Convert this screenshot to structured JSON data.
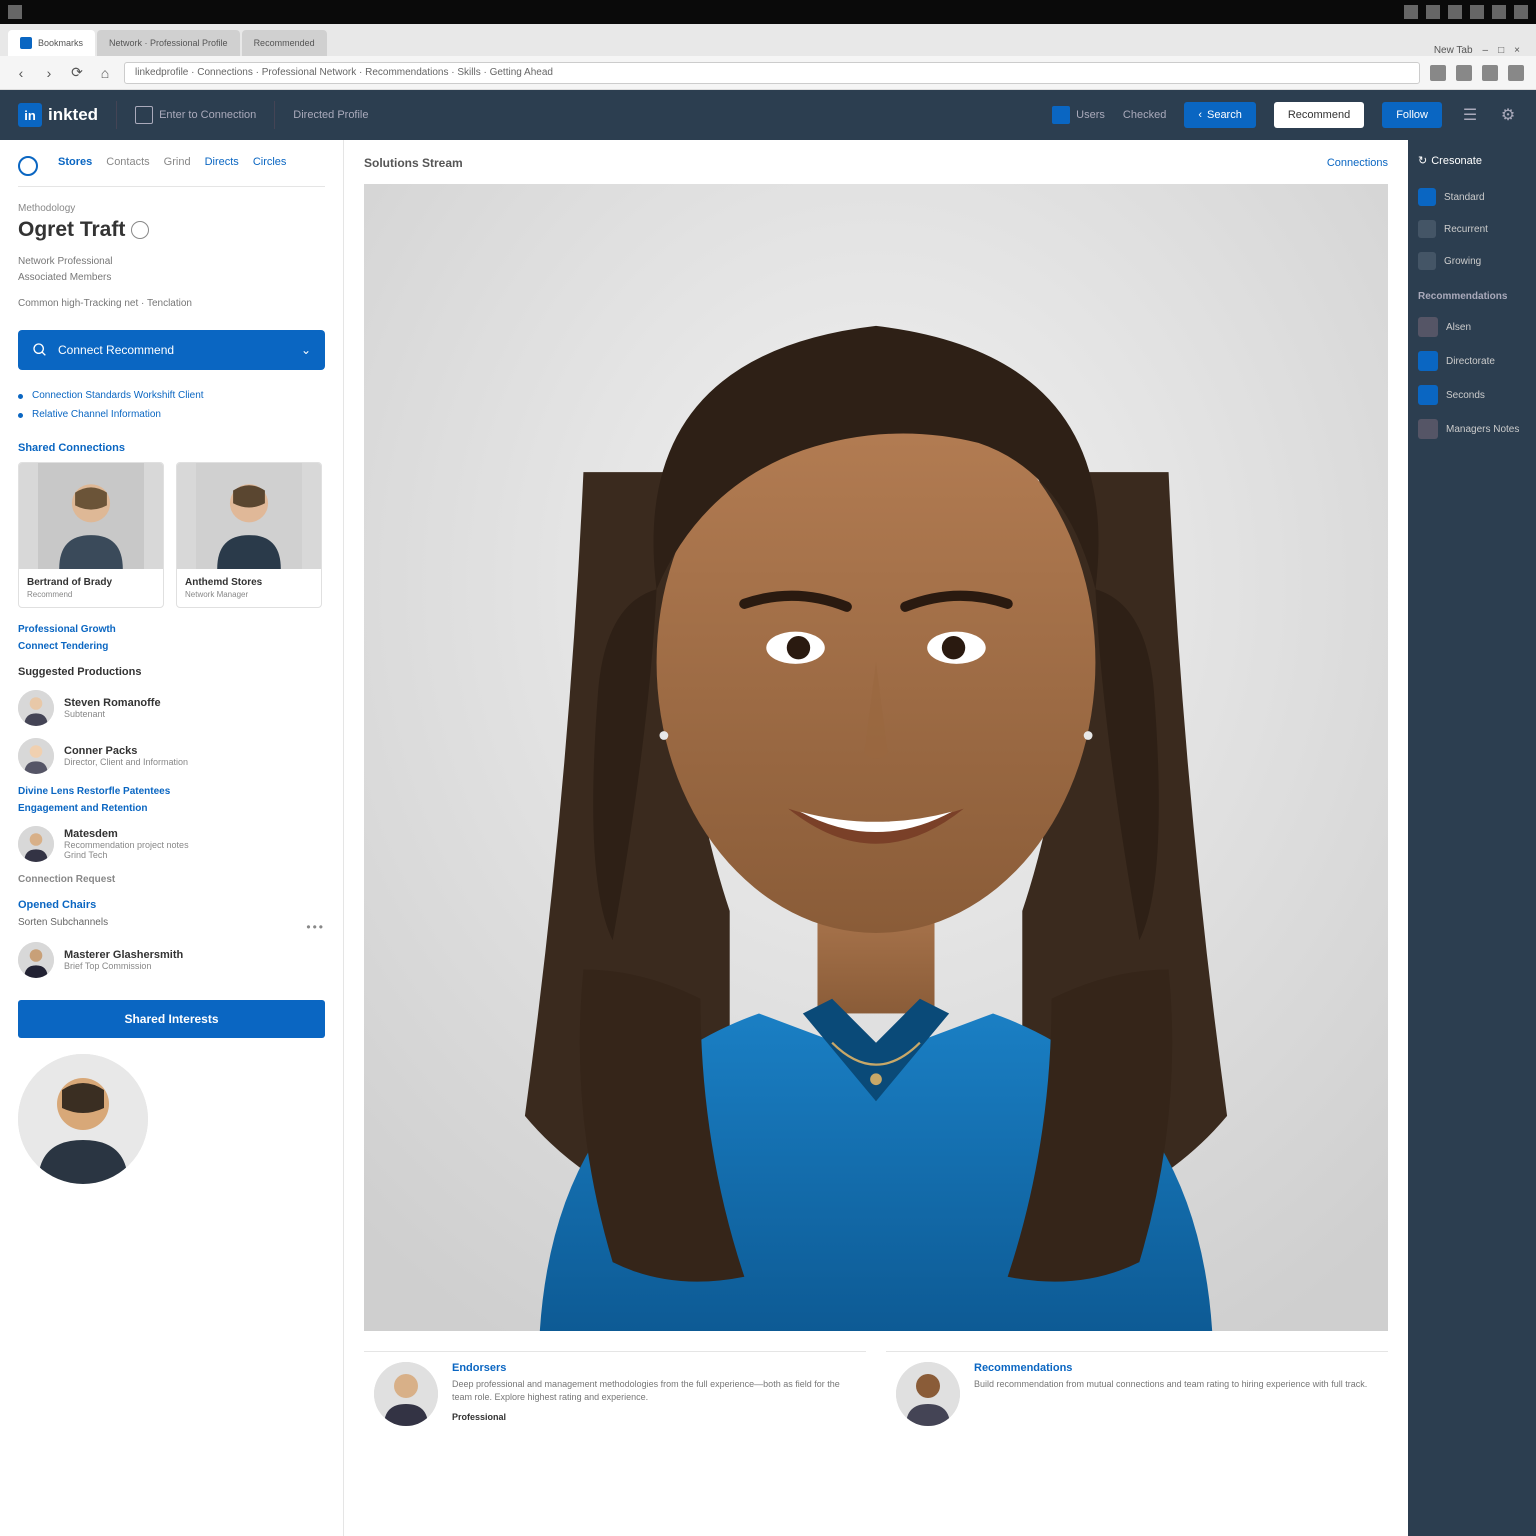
{
  "browser": {
    "tabs": [
      {
        "label": "Bookmarks"
      },
      {
        "label": "Network · Professional Profile"
      },
      {
        "label": "Recommended"
      }
    ],
    "controls": [
      "New Tab",
      "–",
      "□",
      "×"
    ],
    "url": "linkedprofile · Connections · Professional Network · Recommendations · Skills · Getting Ahead"
  },
  "topnav": {
    "brand": "inkted",
    "item1": "Enter to Connection",
    "item2": "Directed Profile",
    "right_label1": "Users",
    "right_label2": "Checked",
    "btn_search": "Search",
    "btn_recommend": "Recommend",
    "btn_follow": "Follow"
  },
  "sidebar": {
    "tabs": [
      "Stores",
      "Contacts",
      "Grind",
      "Directs",
      "Circles"
    ],
    "eyebrow": "Methodology",
    "name": "Ogret Traft",
    "meta1": "Network Professional",
    "meta2": "Associated Members",
    "meta3": "Common high-Tracking net · Tenclation",
    "search_label": "Connect Recommend",
    "bullets": [
      "Connection Standards Workshift Client",
      "Relative Channel Information"
    ],
    "connections_hdr": "Shared Connections",
    "people": [
      {
        "name": "Bertrand of Brady",
        "role": "Recommend"
      },
      {
        "name": "Anthemd Stores",
        "role": "Network Manager"
      }
    ],
    "link1": "Professional Growth",
    "link2": "Connect Tendering",
    "dark_hdr1": "Suggested Productions",
    "mini": [
      {
        "name": "Steven Romanoffe",
        "role": "Subtenant"
      },
      {
        "name": "Conner Packs",
        "role": "Director, Client and Information"
      }
    ],
    "link3": "Divine Lens Restorfle Patentees",
    "link4": "Engagement and Retention",
    "mini2": {
      "name": "Matesdem",
      "role": "Recommendation project notes",
      "sub": "Grind Tech"
    },
    "link5": "Connection Request",
    "dark_hdr2": "Opened Chairs",
    "sub2": "Sorten Subchannels",
    "mini3": {
      "name": "Masterer Glashersmith",
      "role": "Brief Top Commission"
    },
    "shared_btn": "Shared Interests"
  },
  "main": {
    "title": "Solutions Stream",
    "action": "Connections",
    "cards": [
      {
        "title": "Endorsers",
        "desc": "Deep professional and management methodologies from the full experience—both as field for the team role. Explore highest rating and experience.",
        "footer": "Professional"
      },
      {
        "title": "Recommendations",
        "desc": "Build recommendation from mutual connections and team rating to hiring experience with full track."
      }
    ]
  },
  "rightbar": {
    "header": "Cresonate",
    "items1": [
      {
        "label": "Standard"
      },
      {
        "label": "Recurrent"
      },
      {
        "label": "Growing"
      }
    ],
    "section2": "Recommendations",
    "items2": [
      {
        "label": "Alsen"
      },
      {
        "label": "Directorate"
      },
      {
        "label": "Seconds"
      },
      {
        "label": "Managers Notes"
      }
    ]
  }
}
